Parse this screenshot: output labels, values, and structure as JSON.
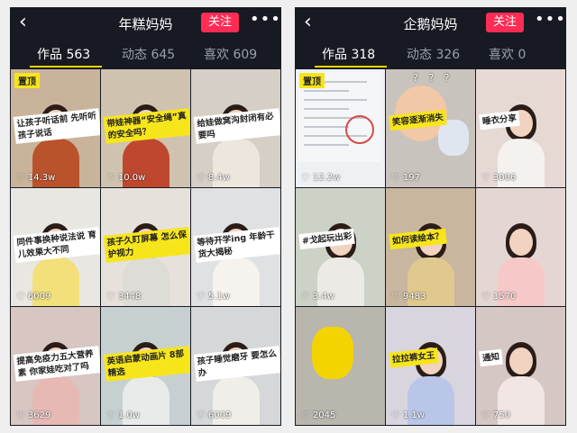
{
  "left": {
    "back": "‹",
    "title": "年糕妈妈",
    "follow_label": "关注",
    "more": "•••",
    "tabs": [
      "作品 563",
      "动态 645",
      "喜欢 609"
    ],
    "videos": [
      {
        "pinned": true,
        "pin_label": "置顶",
        "caption": "让孩子听话前 先听听孩子说话",
        "likes": "14.3w",
        "bg": "#c9b39a",
        "shirt": "#b9532c"
      },
      {
        "pinned": false,
        "caption": "带娃神器“安全绳”真的安全吗？",
        "likes": "10.0w",
        "bg": "#cfc3b0",
        "shirt": "#c0472f"
      },
      {
        "pinned": false,
        "caption": "给娃做窝沟封闭有必要吗",
        "likes": "8.4w",
        "bg": "#d6cfc5",
        "shirt": "#ece6dd"
      },
      {
        "pinned": false,
        "caption": "同件事换种说法说 育儿效果大不同",
        "likes": "6009",
        "bg": "#e9e7e2",
        "shirt": "#f4e07a"
      },
      {
        "pinned": false,
        "caption": "孩子久盯屏幕 怎么保护视力",
        "likes": "3448",
        "bg": "#e6e1da",
        "shirt": "#dddcd6"
      },
      {
        "pinned": false,
        "caption": "等待开学ing 年龄干货大揭秘",
        "likes": "5.1w",
        "bg": "#dfe1e3",
        "shirt": "#f6f3ee"
      },
      {
        "pinned": false,
        "caption": "提高免疫力五大营养素 你家娃吃对了吗",
        "likes": "3629",
        "bg": "#d8c6c2",
        "shirt": "#e7b9b5"
      },
      {
        "pinned": false,
        "caption": "英语启蒙动画片 8部精选",
        "likes": "1.0w",
        "bg": "#c7d0d1",
        "shirt": "#e9eaea"
      },
      {
        "pinned": false,
        "caption": "孩子睡觉磨牙 要怎么办",
        "likes": "6009",
        "bg": "#d5d7d8",
        "shirt": "#f0eee8"
      }
    ]
  },
  "right": {
    "back": "‹",
    "title": "企鹅妈妈",
    "follow_label": "关注",
    "more": "•••",
    "tabs": [
      "作品 318",
      "动态 326",
      "喜欢 0"
    ],
    "videos": [
      {
        "pinned": true,
        "pin_label": "置顶",
        "caption": "",
        "likes": "12.2w",
        "bg": "#eef1f3",
        "kind": "doc"
      },
      {
        "pinned": false,
        "caption": "笑容逐渐消失",
        "likes": "197",
        "bg": "#c9c3bd",
        "kind": "baby",
        "extra": "? ? ?"
      },
      {
        "pinned": false,
        "caption": "睡衣分享",
        "likes": "3006",
        "bg": "#e6d9d4",
        "shirt": "#f4f1ef"
      },
      {
        "pinned": false,
        "caption": "#戈起玩出彩",
        "likes": "3.4w",
        "bg": "#cdd2c7",
        "shirt": "#eceae4"
      },
      {
        "pinned": false,
        "caption": "如何读绘本？",
        "likes": "9483",
        "bg": "#c9b69e",
        "shirt": "#e0c98e"
      },
      {
        "pinned": false,
        "caption": "",
        "likes": "1570",
        "bg": "#e4d6d2",
        "shirt": "#f6c9c8"
      },
      {
        "pinned": false,
        "caption": "",
        "likes": "2045",
        "bg": "#b9b6ae",
        "kind": "toy"
      },
      {
        "pinned": false,
        "caption": "拉拉裤女王",
        "likes": "1.1w",
        "bg": "#d8d5df",
        "shirt": "#b9c6e8"
      },
      {
        "pinned": false,
        "caption": "通知",
        "likes": "750",
        "bg": "#d5c7c4",
        "shirt": "#f2e6e5"
      }
    ]
  }
}
